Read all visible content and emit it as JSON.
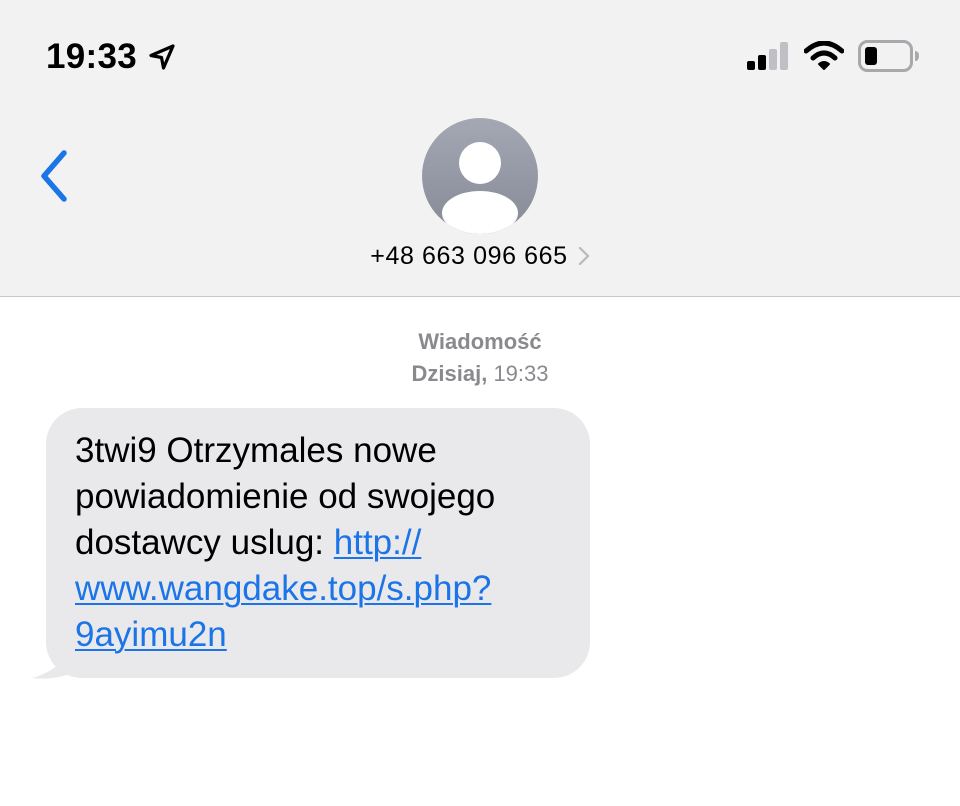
{
  "status_bar": {
    "time": "19:33",
    "location_icon": "location-arrow-icon",
    "signal_icon": "cellular-signal-icon",
    "wifi_icon": "wifi-icon",
    "battery_icon": "battery-low-icon",
    "battery_color": "#000000"
  },
  "nav": {
    "back_icon": "chevron-left-icon",
    "avatar_icon": "person-silhouette-icon",
    "contact_number": "+48 663 096 665",
    "details_icon": "chevron-right-icon",
    "accent_color": "#1b74e8"
  },
  "thread": {
    "meta_label": "Wiadomość",
    "meta_day": "Dzisiaj,",
    "meta_time": "19:33"
  },
  "message": {
    "lines": [
      "3twi9 Otrzymales nowe",
      "powiadomienie od swojego",
      "dostawcy uslug:"
    ],
    "link_lines": [
      "http://",
      "www.wangdake.top/s.php?",
      "9ayimu2n"
    ],
    "bubble_color": "#e9e9eb",
    "link_color": "#1b74e8"
  }
}
